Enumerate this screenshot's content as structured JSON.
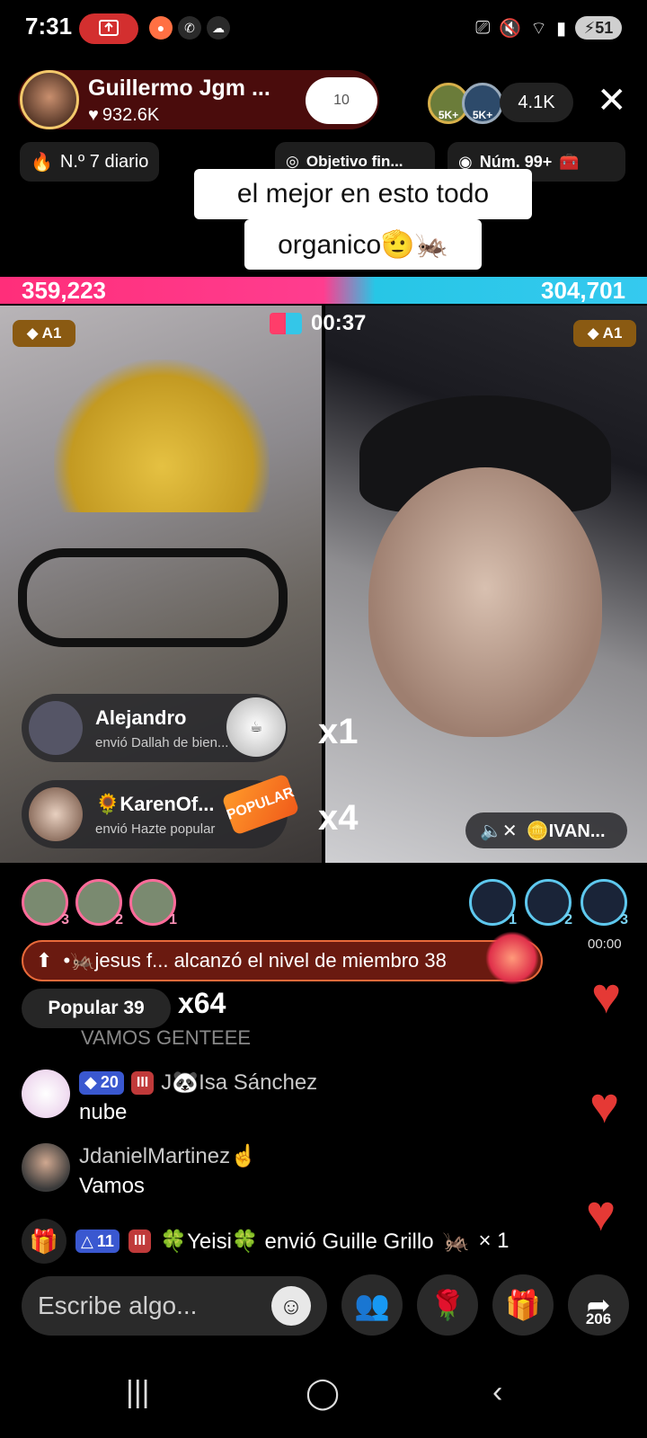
{
  "status_bar": {
    "time": "7:31",
    "battery": "51",
    "icons_left": [
      "screen-record-icon",
      "camera-app-icon",
      "whatsapp-icon",
      "weather-icon"
    ],
    "icons_right": [
      "cast-icon",
      "mute-icon",
      "wifi-icon",
      "signal-icon",
      "battery-icon"
    ]
  },
  "host": {
    "name": "Guillermo Jgm ...",
    "likes": "932.6K",
    "follow_badge": "10"
  },
  "viewers": {
    "badges": [
      "5K+",
      "5K+"
    ],
    "count": "4.1K"
  },
  "chips": {
    "daily": "N.º 7 diario",
    "goal": "Objetivo fin...",
    "rank": "Núm. 99+"
  },
  "caption": {
    "line1": "el mejor en esto todo",
    "line2": "organico🫡🦗"
  },
  "battle": {
    "score_left": "359,223",
    "score_right": "304,701",
    "timer": "00:37",
    "tag_left": "A1",
    "tag_right": "A1",
    "colors": {
      "left": "#ff2e7a",
      "right": "#27c6e6"
    }
  },
  "gifts": [
    {
      "name": "Alejandro",
      "desc": "envió Dallah de bien...",
      "combo": "x1"
    },
    {
      "name": "🌻KarenOf...",
      "desc": "envió Hazte popular",
      "combo": "x4",
      "item_label": "POPULAR"
    }
  ],
  "opponent_mute": {
    "name": "🪙IVAN..."
  },
  "ranking_left": [
    "3",
    "2",
    "1"
  ],
  "ranking_right": [
    "1",
    "2",
    "3"
  ],
  "small_time": "00:00",
  "feed": {
    "member_banner": "•🦗jesus f... alcanzó el nivel de miembro 38",
    "popular_chip": "Popular 39",
    "popular_combo": "x64",
    "cut_text": "VAMOS GENTEEE",
    "comments": [
      {
        "level": "20",
        "club": "III",
        "user": "J🐼Isa Sánchez",
        "text": "nube"
      },
      {
        "user": "JdanielMartinez☝️",
        "text": "Vamos"
      }
    ],
    "gift_line": {
      "level": "11",
      "club": "III",
      "text": "🍀Yeisi🍀 envió Guille Grillo",
      "count": "× 1"
    }
  },
  "bottom_bar": {
    "input_placeholder": "Escribe algo...",
    "share_count": "206"
  }
}
